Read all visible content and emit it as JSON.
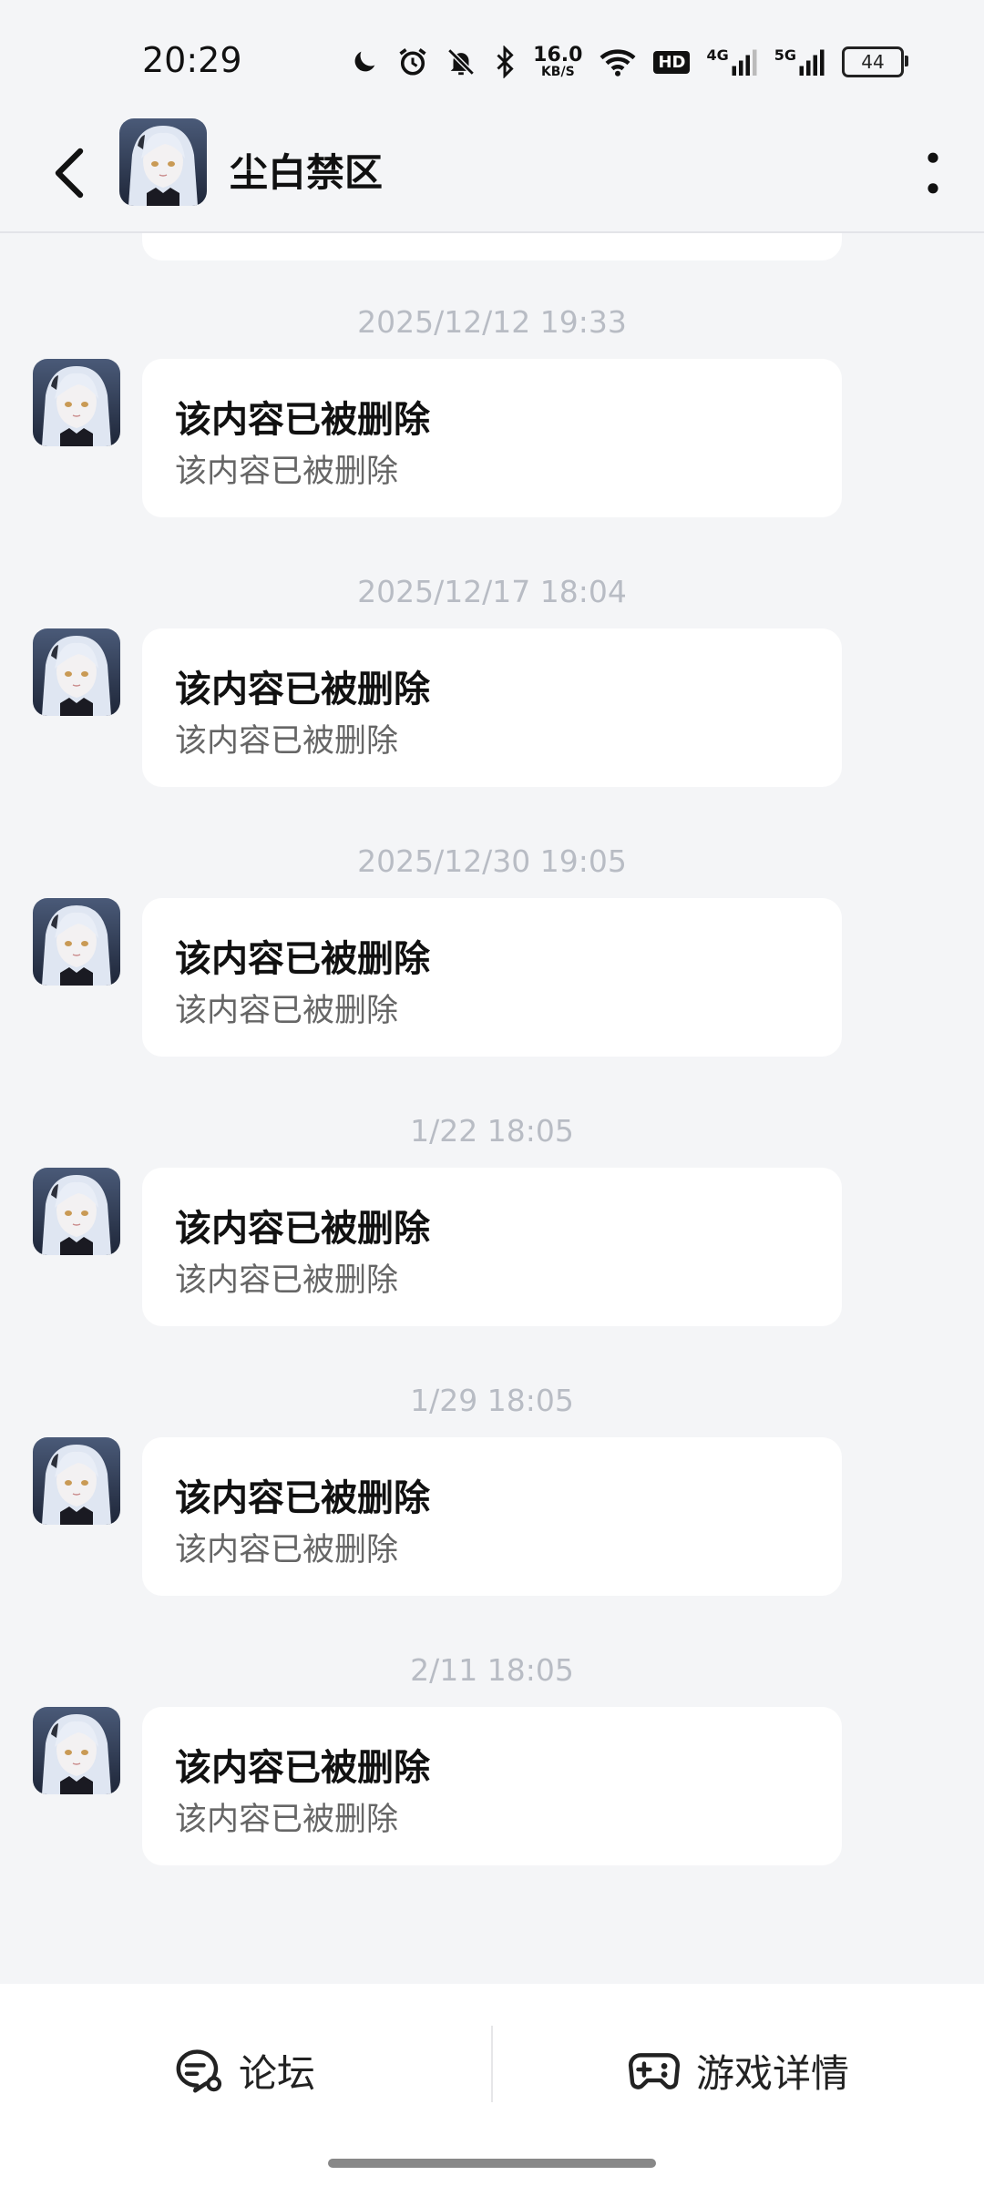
{
  "status_bar": {
    "time": "20:29",
    "net_speed": "16.0",
    "net_unit": "KB/S",
    "hd_label": "HD",
    "signal1_label": "4G",
    "signal2_label": "5G",
    "battery": "44",
    "icons": [
      "moon-icon",
      "alarm-icon",
      "bell-muted-icon",
      "bluetooth-icon",
      "wifi-icon",
      "signal-icon",
      "battery-icon"
    ]
  },
  "header": {
    "title": "尘白禁区",
    "back_icon": "chevron-left-icon",
    "more_icon": "more-vertical-icon"
  },
  "messages": [
    {
      "time": "2025/12/12  19:33",
      "title": "该内容已被删除",
      "text": "该内容已被删除"
    },
    {
      "time": "2025/12/17  18:04",
      "title": "该内容已被删除",
      "text": "该内容已被删除"
    },
    {
      "time": "2025/12/30  19:05",
      "title": "该内容已被删除",
      "text": "该内容已被删除"
    },
    {
      "time": "1/22  18:05",
      "title": "该内容已被删除",
      "text": "该内容已被删除"
    },
    {
      "time": "1/29  18:05",
      "title": "该内容已被删除",
      "text": "该内容已被删除"
    },
    {
      "time": "2/11  18:05",
      "title": "该内容已被删除",
      "text": "该内容已被删除"
    }
  ],
  "bottom_bar": {
    "forum_label": "论坛",
    "game_label": "游戏详情"
  },
  "colors": {
    "background": "#f4f5f7",
    "bubble": "#ffffff",
    "timestamp": "#b8bcc4",
    "subtext": "#666666"
  }
}
